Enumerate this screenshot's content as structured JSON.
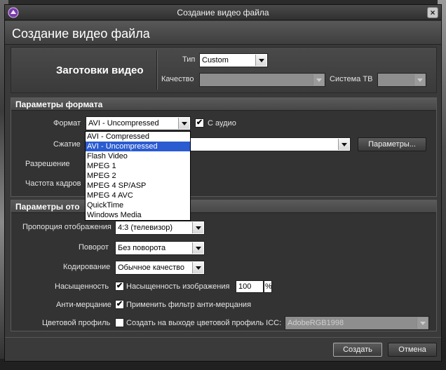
{
  "window": {
    "title": "Создание видео файла",
    "close_glyph": "×"
  },
  "header": {
    "title": "Создание видео файла"
  },
  "presets": {
    "title": "Заготовки видео",
    "type_label": "Тип",
    "type_value": "Custom",
    "quality_label": "Качество",
    "quality_value": "",
    "tv_label": "Система ТВ",
    "tv_value": ""
  },
  "format_section": {
    "title": "Параметры формата",
    "format_label": "Формат",
    "format_value": "AVI - Uncompressed",
    "audio_label": "С аудио",
    "audio_checked": true,
    "compression_label": "Сжатие",
    "params_button": "Параметры...",
    "resolution_label": "Разрешение",
    "framerate_label": "Частота кадров",
    "dropdown_options": [
      "AVI - Compressed",
      "AVI - Uncompressed",
      "Flash Video",
      "MPEG 1",
      "MPEG 2",
      "MPEG 4 SP/ASP",
      "MPEG 4 AVC",
      "QuickTime",
      "Windows Media"
    ],
    "dropdown_selected": "AVI - Uncompressed"
  },
  "display_section": {
    "title": "Параметры ото",
    "aspect_label": "Пропорция отображения",
    "aspect_value": "4:3 (телевизор)",
    "rotation_label": "Поворот",
    "rotation_value": "Без поворота",
    "encoding_label": "Кодирование",
    "encoding_value": "Обычное качество",
    "saturation_label": "Насыщенность",
    "saturation_cb_label": "Насыщенность изображения",
    "saturation_value": "100",
    "saturation_unit": "%",
    "antiflicker_label": "Анти-мерцание",
    "antiflicker_cb_label": "Применить фильтр анти-мерцания",
    "color_profile_label": "Цветовой профиль",
    "color_profile_cb_label": "Создать на выходе цветовой профиль ICC:",
    "color_profile_value": "AdobeRGB1998"
  },
  "footer": {
    "create_button": "Создать",
    "cancel_button": "Отмена"
  },
  "icons": {
    "check": "✔",
    "app": "app-icon"
  }
}
